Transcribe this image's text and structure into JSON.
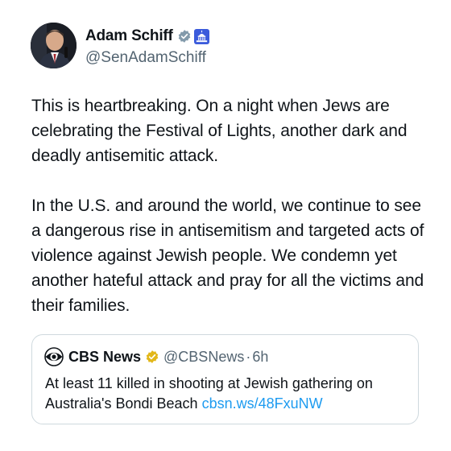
{
  "author": {
    "display_name": "Adam Schiff",
    "handle": "@SenAdamSchiff"
  },
  "tweet": {
    "paragraphs": [
      "This is heartbreaking. On a night when Jews are celebrating the Festival of Lights, another dark and deadly antisemitic attack.",
      "In the U.S. and around the world, we continue to see a dangerous rise in antisemitism and targeted acts of violence against Jewish people. We condemn yet another hateful attack and pray for all the victims and their families."
    ]
  },
  "quoted_tweet": {
    "display_name": "CBS News",
    "handle": "@CBSNews",
    "separator": "·",
    "time": "6h",
    "text": "At least 11 killed in shooting at Jewish gathering on Australia's Bondi Beach",
    "link": "cbsn.ws/48FxuNW"
  },
  "colors": {
    "verified_badge": "#829aab",
    "gold_badge": "#e2b719",
    "link": "#1d9bf0",
    "secondary_text": "#536471"
  },
  "icons": [
    "avatar",
    "verified-badge-icon",
    "capitol-icon",
    "cbs-eye-logo-icon",
    "gold-verified-badge-icon"
  ]
}
